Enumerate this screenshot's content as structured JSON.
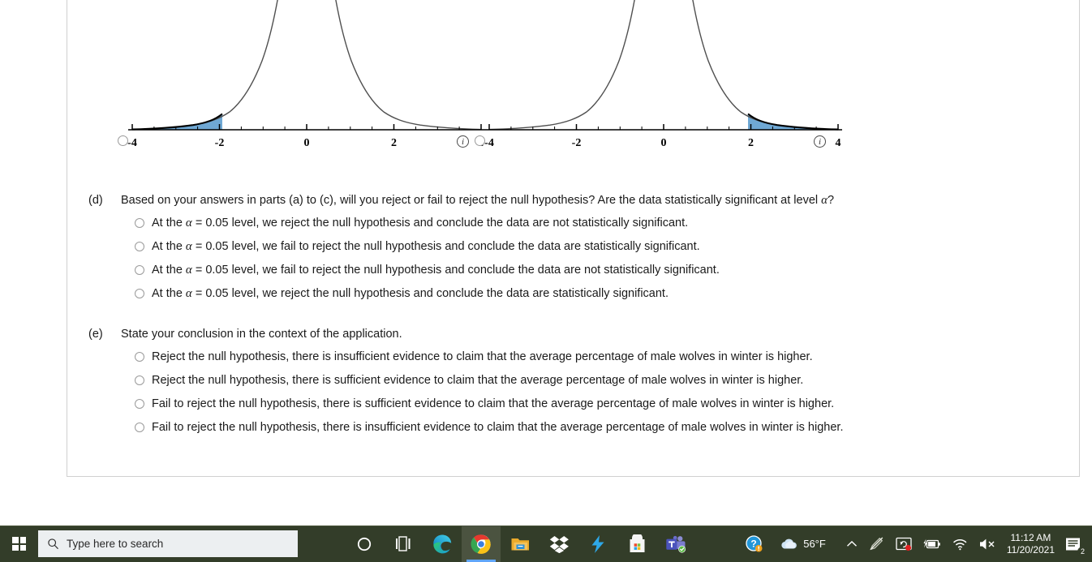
{
  "charts": [
    {
      "name": "t-distribution-left-tail",
      "type": "area",
      "xlabel": "",
      "ylabel": "",
      "xlim": [
        -4.6,
        4.6
      ],
      "tick_labels": [
        "-4",
        "-2",
        "0",
        "2",
        "4"
      ],
      "tick_values": [
        -4,
        -2,
        0,
        2,
        4
      ],
      "minor_tick_step": 0.5,
      "curve": "student-t",
      "df": 8,
      "shaded_region": "left-tail",
      "shade_from": -4.6,
      "shade_to": -1.75,
      "shade_color": "#6FA8D4",
      "curve_color": "#4f4f4f",
      "grid": false,
      "radio_label": "select-left-graph",
      "info_label": "i"
    },
    {
      "name": "t-distribution-right-tail",
      "type": "area",
      "xlabel": "",
      "ylabel": "",
      "xlim": [
        -4.6,
        4.6
      ],
      "tick_labels": [
        "-4",
        "-2",
        "0",
        "2",
        "4"
      ],
      "tick_values": [
        -4,
        -2,
        0,
        2,
        4
      ],
      "minor_tick_step": 0.5,
      "curve": "student-t",
      "df": 8,
      "shaded_region": "right-tail",
      "shade_from": 1.75,
      "shade_to": 4.6,
      "shade_color": "#6FA8D4",
      "curve_color": "#4f4f4f",
      "grid": false,
      "radio_label": "select-right-graph",
      "info_label": "i"
    }
  ],
  "chart_data": {
    "type": "area",
    "title": "",
    "xlabel": "",
    "ylabel": "",
    "xlim": [
      -4.6,
      4.6
    ],
    "grid": false,
    "legend": "none",
    "panels": [
      {
        "name": "left-tail",
        "tick_labels": [
          "-4",
          "-2",
          "0",
          "2",
          "4"
        ],
        "tick_values": [
          -4,
          -2,
          0,
          2,
          4
        ],
        "shaded_from": -4.6,
        "shaded_to": -1.75,
        "shade_color": "#6FA8D4"
      },
      {
        "name": "right-tail",
        "tick_labels": [
          "-4",
          "-2",
          "0",
          "2",
          "4"
        ],
        "tick_values": [
          -4,
          -2,
          0,
          2,
          4
        ],
        "shaded_from": 1.75,
        "shaded_to": 4.6,
        "shade_color": "#6FA8D4"
      }
    ]
  },
  "part_d": {
    "label": "(d)",
    "prompt_pre": "Based on your answers in parts (a) to (c), will you reject or fail to reject the null hypothesis? Are the data statistically significant at level ",
    "prompt_var": "α",
    "prompt_post": "?",
    "options": [
      {
        "pre": "At the ",
        "var": "α",
        "post": " = 0.05 level, we reject the null hypothesis and conclude the data are not statistically significant."
      },
      {
        "pre": "At the ",
        "var": "α",
        "post": " = 0.05 level, we fail to reject the null hypothesis and conclude the data are statistically significant."
      },
      {
        "pre": "At the ",
        "var": "α",
        "post": " = 0.05 level, we fail to reject the null hypothesis and conclude the data are not statistically significant."
      },
      {
        "pre": "At the ",
        "var": "α",
        "post": " = 0.05 level, we reject the null hypothesis and conclude the data are statistically significant."
      }
    ]
  },
  "part_e": {
    "label": "(e)",
    "prompt": "State your conclusion in the context of the application.",
    "options": [
      "Reject the null hypothesis, there is insufficient evidence to claim that the average percentage of male wolves in winter is higher.",
      "Reject the null hypothesis, there is sufficient evidence to claim that the average percentage of male wolves in winter is higher.",
      "Fail to reject the null hypothesis, there is sufficient evidence to claim that the average percentage of male wolves in winter is higher.",
      "Fail to reject the null hypothesis, there is insufficient evidence to claim that the average percentage of male wolves in winter is higher."
    ]
  },
  "taskbar": {
    "search_placeholder": "Type here to search",
    "icons": [
      {
        "name": "task-view-icon"
      },
      {
        "name": "microsoft-edge-icon"
      },
      {
        "name": "google-chrome-icon"
      },
      {
        "name": "file-explorer-icon"
      },
      {
        "name": "dropbox-icon"
      },
      {
        "name": "lightning-app-icon"
      },
      {
        "name": "microsoft-store-icon"
      },
      {
        "name": "microsoft-teams-icon"
      }
    ],
    "tray": {
      "help_icon": "help-circle-icon",
      "weather_icon": "cloud-icon",
      "temperature": "56°F",
      "show_hidden_icon": "chevron-up-icon",
      "pen_icon": "pen-disabled-icon",
      "screen_share_icon": "screen-recording-icon",
      "battery_icon": "battery-charging-icon",
      "network_icon": "wifi-icon",
      "volume_icon": "speaker-muted-icon",
      "time": "11:12 AM",
      "date": "11/20/2021",
      "notifications_icon": "notifications-icon",
      "notifications_count": "2"
    }
  }
}
